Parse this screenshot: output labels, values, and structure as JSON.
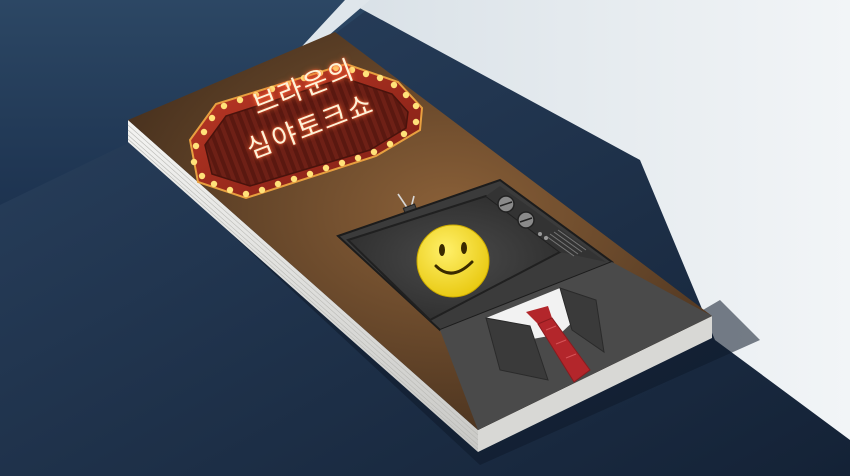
{
  "poster": {
    "title_line1": "브라운의",
    "title_line2": "심야토크쇼"
  },
  "colors": {
    "floor": "#1c2f45",
    "wall": "#e6ecf0",
    "poster_bg": "#6a4a30",
    "marquee_frame": "#9c2a1e",
    "bulb": "#ffe27a",
    "tv_body": "#3b3b3b",
    "smiley": "#f4dc1e",
    "suit": "#4a4a4a",
    "tie": "#b3262b"
  },
  "icons": {
    "smiley": "smiley-face-icon",
    "tv": "television-icon",
    "antenna": "antenna-icon"
  }
}
